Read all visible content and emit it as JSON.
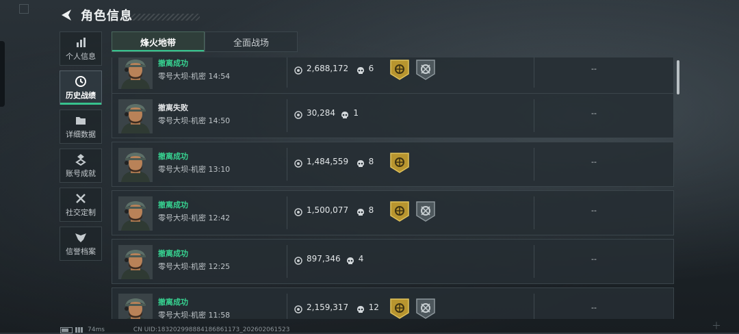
{
  "header": {
    "title": "角色信息"
  },
  "sidebar": {
    "items": [
      {
        "label": "个人信息",
        "icon": "bar-chart-icon"
      },
      {
        "label": "历史战绩",
        "icon": "clock-icon",
        "active": true
      },
      {
        "label": "详细数据",
        "icon": "folder-icon"
      },
      {
        "label": "账号成就",
        "icon": "medal-icon"
      },
      {
        "label": "社交定制",
        "icon": "tools-icon"
      },
      {
        "label": "信誉档案",
        "icon": "shield-wings-icon"
      }
    ]
  },
  "tabs": [
    {
      "label": "烽火地带",
      "active": true
    },
    {
      "label": "全面战场",
      "active": false
    }
  ],
  "records": [
    {
      "status": "撤离成功",
      "success": true,
      "map": "零号大坝-机密",
      "time": "14:54",
      "value": "2,688,172",
      "kills": "6",
      "badges": [
        "gold-shield-badge-icon",
        "grey-crosshair-badge-icon"
      ],
      "extra": "--"
    },
    {
      "status": "撤离失败",
      "success": false,
      "map": "零号大坝-机密",
      "time": "14:50",
      "value": "30,284",
      "kills": "1",
      "badges": [],
      "extra": "--"
    },
    {
      "status": "撤离成功",
      "success": true,
      "map": "零号大坝-机密",
      "time": "13:10",
      "value": "1,484,559",
      "kills": "8",
      "badges": [
        "gold-shield-badge-icon"
      ],
      "extra": "--"
    },
    {
      "status": "撤离成功",
      "success": true,
      "map": "零号大坝-机密",
      "time": "12:42",
      "value": "1,500,077",
      "kills": "8",
      "badges": [
        "gold-shield-badge-icon",
        "grey-crosshair-badge-icon"
      ],
      "extra": "--"
    },
    {
      "status": "撤离成功",
      "success": true,
      "map": "零号大坝-机密",
      "time": "12:25",
      "value": "897,346",
      "kills": "4",
      "badges": [],
      "extra": "--"
    },
    {
      "status": "撤离成功",
      "success": true,
      "map": "零号大坝-机密",
      "time": "11:58",
      "value": "2,159,317",
      "kills": "12",
      "badges": [
        "gold-shield-badge-icon",
        "grey-crosshair-badge-icon"
      ],
      "extra": "--"
    }
  ],
  "statusbar": {
    "ping": "74ms",
    "uid": "CN UID:183202998884186861173_202602061523"
  },
  "colors": {
    "success": "#37d391",
    "accent": "#37c28e",
    "badge_gold": "#c9a43a",
    "badge_grey": "#7f8a8f"
  }
}
